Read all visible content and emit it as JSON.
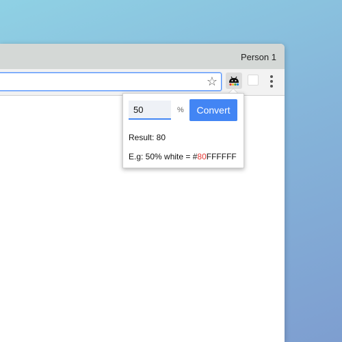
{
  "window": {
    "profile_name": "Person 1"
  },
  "toolbar": {
    "star_icon": "☆",
    "extension_icon": "android-robot-icon",
    "menu_icon": "three-dot-menu-icon"
  },
  "popup": {
    "percent_value": "50",
    "percent_sign": "%",
    "convert_label": "Convert",
    "result_text": "Result: 80",
    "example_prefix": "E.g: 50% white = #",
    "example_highlight": "80",
    "example_suffix": "FFFFFF",
    "highlight_color": "#e53935",
    "accent_color": "#4285f4"
  }
}
